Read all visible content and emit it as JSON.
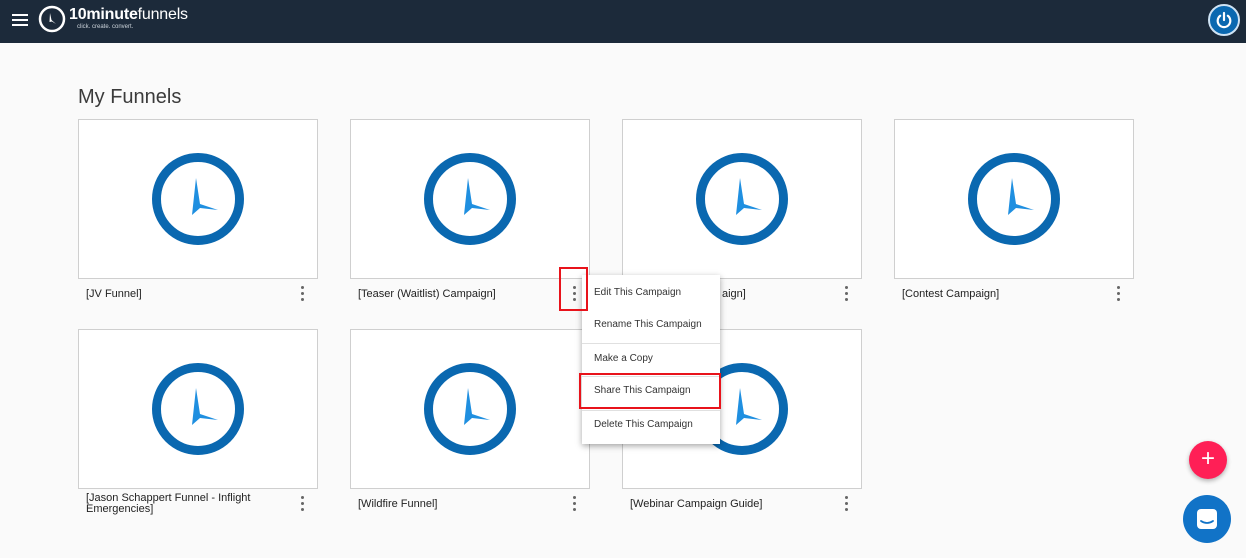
{
  "app": {
    "logo_bold": "10minute",
    "logo_light": "funnels",
    "tagline": "click. create. convert."
  },
  "page": {
    "title": "My Funnels"
  },
  "funnels": [
    {
      "name": "[JV Funnel]"
    },
    {
      "name": "[Teaser (Waitlist) Campaign]"
    },
    {
      "name": "aign]"
    },
    {
      "name": "[Contest Campaign]"
    },
    {
      "name": "[Jason Schappert Funnel - Inflight Emergencies]"
    },
    {
      "name": "[Wildfire Funnel]"
    },
    {
      "name": "[Webinar Campaign Guide]"
    }
  ],
  "menu": {
    "items": [
      {
        "label": "Edit This Campaign"
      },
      {
        "label": "Rename This Campaign"
      },
      {
        "label": "Make a Copy"
      },
      {
        "label": "Share This Campaign"
      },
      {
        "label": "Delete This Campaign"
      }
    ]
  },
  "fab": {
    "label": "+"
  },
  "colors": {
    "topbar": "#1c2a3a",
    "clock_ring": "#0a68b0",
    "clock_hand": "#1f8fe0",
    "highlight": "#e8131b",
    "fab": "#ff1f56",
    "chat": "#1173c7"
  }
}
